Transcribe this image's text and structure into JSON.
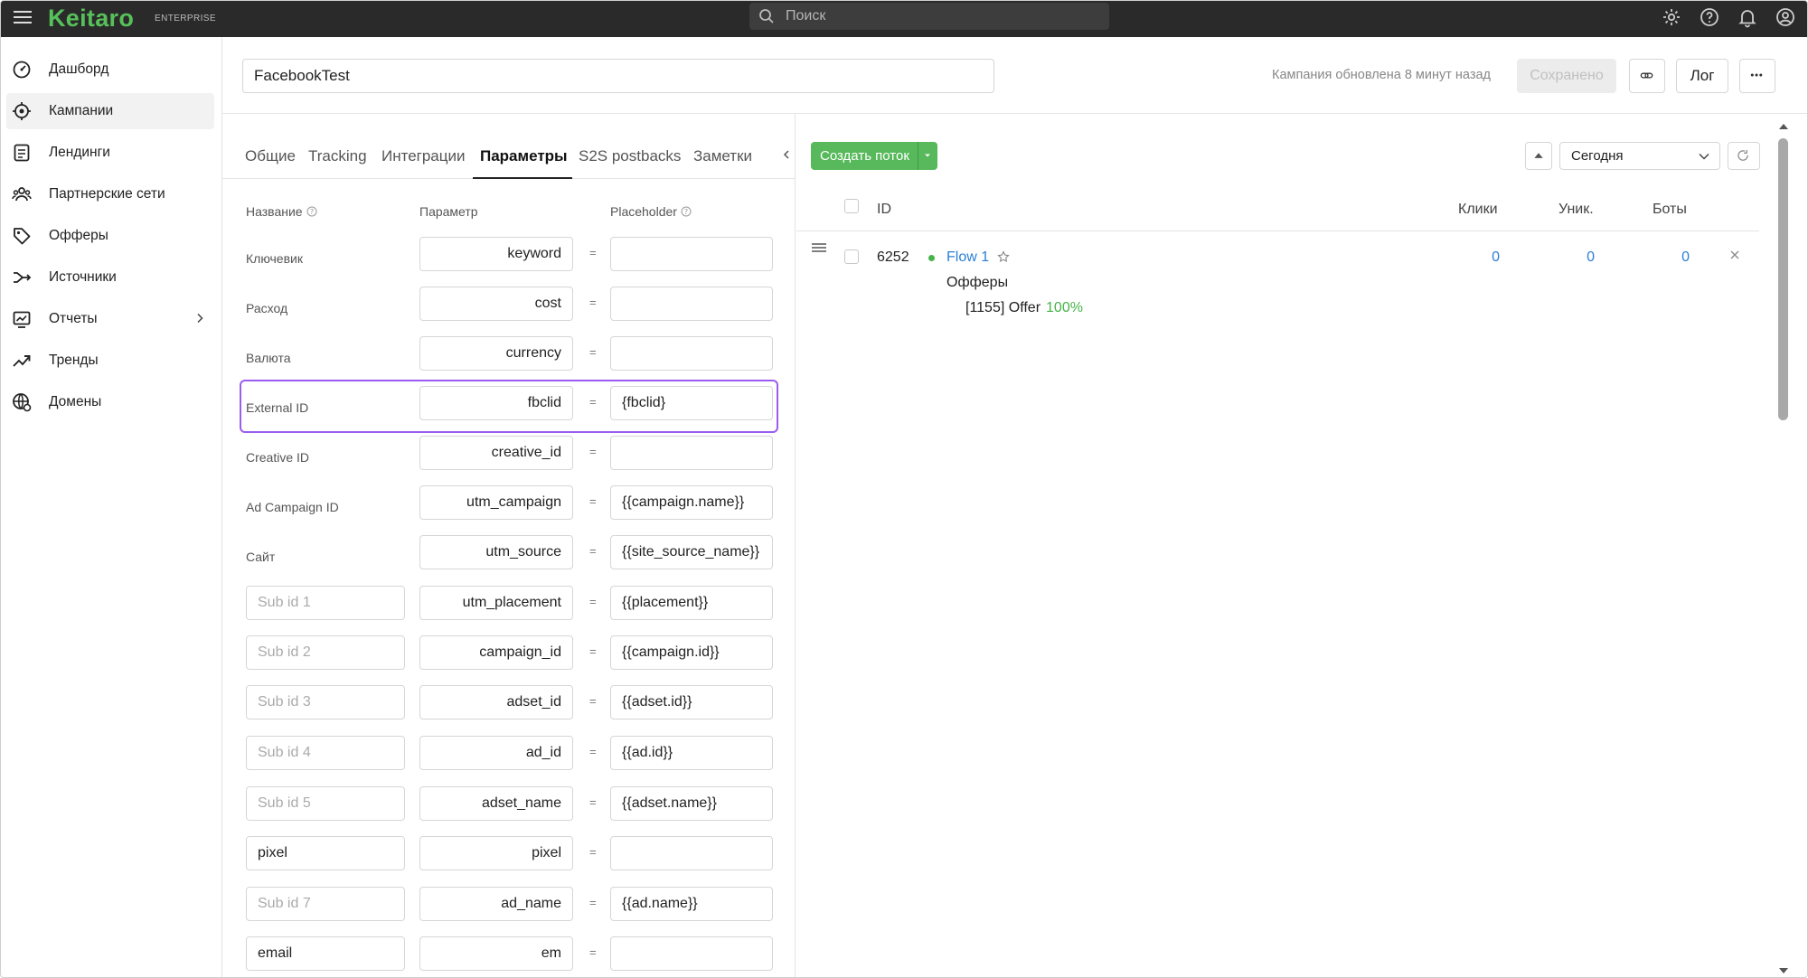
{
  "app": {
    "logo": "Keitaro",
    "edition": "ENTERPRISE",
    "search_placeholder": "Поиск"
  },
  "sidebar": {
    "items": [
      {
        "label": "Дашборд",
        "icon": "dashboard-icon"
      },
      {
        "label": "Кампании",
        "icon": "campaigns-icon",
        "active": true
      },
      {
        "label": "Лендинги",
        "icon": "landings-icon"
      },
      {
        "label": "Партнерские сети",
        "icon": "partners-icon"
      },
      {
        "label": "Офферы",
        "icon": "offers-icon"
      },
      {
        "label": "Источники",
        "icon": "sources-icon"
      },
      {
        "label": "Отчеты",
        "icon": "reports-icon",
        "has_submenu": true
      },
      {
        "label": "Тренды",
        "icon": "trends-icon"
      },
      {
        "label": "Домены",
        "icon": "domains-icon"
      }
    ]
  },
  "header": {
    "campaign_name": "FacebookTest",
    "updated_text": "Кампания обновлена 8 минут назад",
    "saved_label": "Сохранено",
    "log_label": "Лог"
  },
  "tabs": [
    "Общие",
    "Tracking",
    "Интеграции",
    "Параметры",
    "S2S postbacks",
    "Заметки"
  ],
  "active_tab": "Параметры",
  "params": {
    "col_name": "Название",
    "col_param": "Параметр",
    "col_placeholder": "Placeholder",
    "rows": [
      {
        "name": "Ключевик",
        "param": "keyword",
        "placeholder": ""
      },
      {
        "name": "Расход",
        "param": "cost",
        "placeholder": ""
      },
      {
        "name": "Валюта",
        "param": "currency",
        "placeholder": ""
      },
      {
        "name": "External ID",
        "param": "fbclid",
        "placeholder": "{fbclid}"
      },
      {
        "name": "Creative ID",
        "param": "creative_id",
        "placeholder": ""
      },
      {
        "name": "Ad Campaign ID",
        "param": "utm_campaign",
        "placeholder": "{{campaign.name}}"
      },
      {
        "name": "Сайт",
        "param": "utm_source",
        "placeholder": "{{site_source_name}}"
      },
      {
        "sub_placeholder": "Sub id 1",
        "sub_value": "",
        "param": "utm_placement",
        "placeholder": "{{placement}}"
      },
      {
        "sub_placeholder": "Sub id 2",
        "sub_value": "",
        "param": "campaign_id",
        "placeholder": "{{campaign.id}}"
      },
      {
        "sub_placeholder": "Sub id 3",
        "sub_value": "",
        "param": "adset_id",
        "placeholder": "{{adset.id}}"
      },
      {
        "sub_placeholder": "Sub id 4",
        "sub_value": "",
        "param": "ad_id",
        "placeholder": "{{ad.id}}"
      },
      {
        "sub_placeholder": "Sub id 5",
        "sub_value": "",
        "param": "adset_name",
        "placeholder": "{{adset.name}}"
      },
      {
        "sub_placeholder": "",
        "sub_value": "pixel",
        "param": "pixel",
        "placeholder": ""
      },
      {
        "sub_placeholder": "Sub id 7",
        "sub_value": "",
        "param": "ad_name",
        "placeholder": "{{ad.name}}"
      },
      {
        "sub_placeholder": "",
        "sub_value": "email",
        "param": "em",
        "placeholder": ""
      }
    ]
  },
  "flows": {
    "create_label": "Создать поток",
    "date_range": "Сегодня",
    "headers": {
      "id": "ID",
      "clicks": "Клики",
      "uniq": "Уник.",
      "bots": "Боты"
    },
    "items": [
      {
        "id": "6252",
        "name": "Flow 1",
        "clicks": "0",
        "uniq": "0",
        "bots": "0",
        "offers_label": "Офферы",
        "offer": "[1155] Offer",
        "offer_pct": "100%"
      }
    ]
  },
  "colors": {
    "brand_green": "#57c05a",
    "button_green": "#57b95b",
    "link_blue": "#2a7fd4",
    "highlight_purple": "#9b5cf0"
  }
}
